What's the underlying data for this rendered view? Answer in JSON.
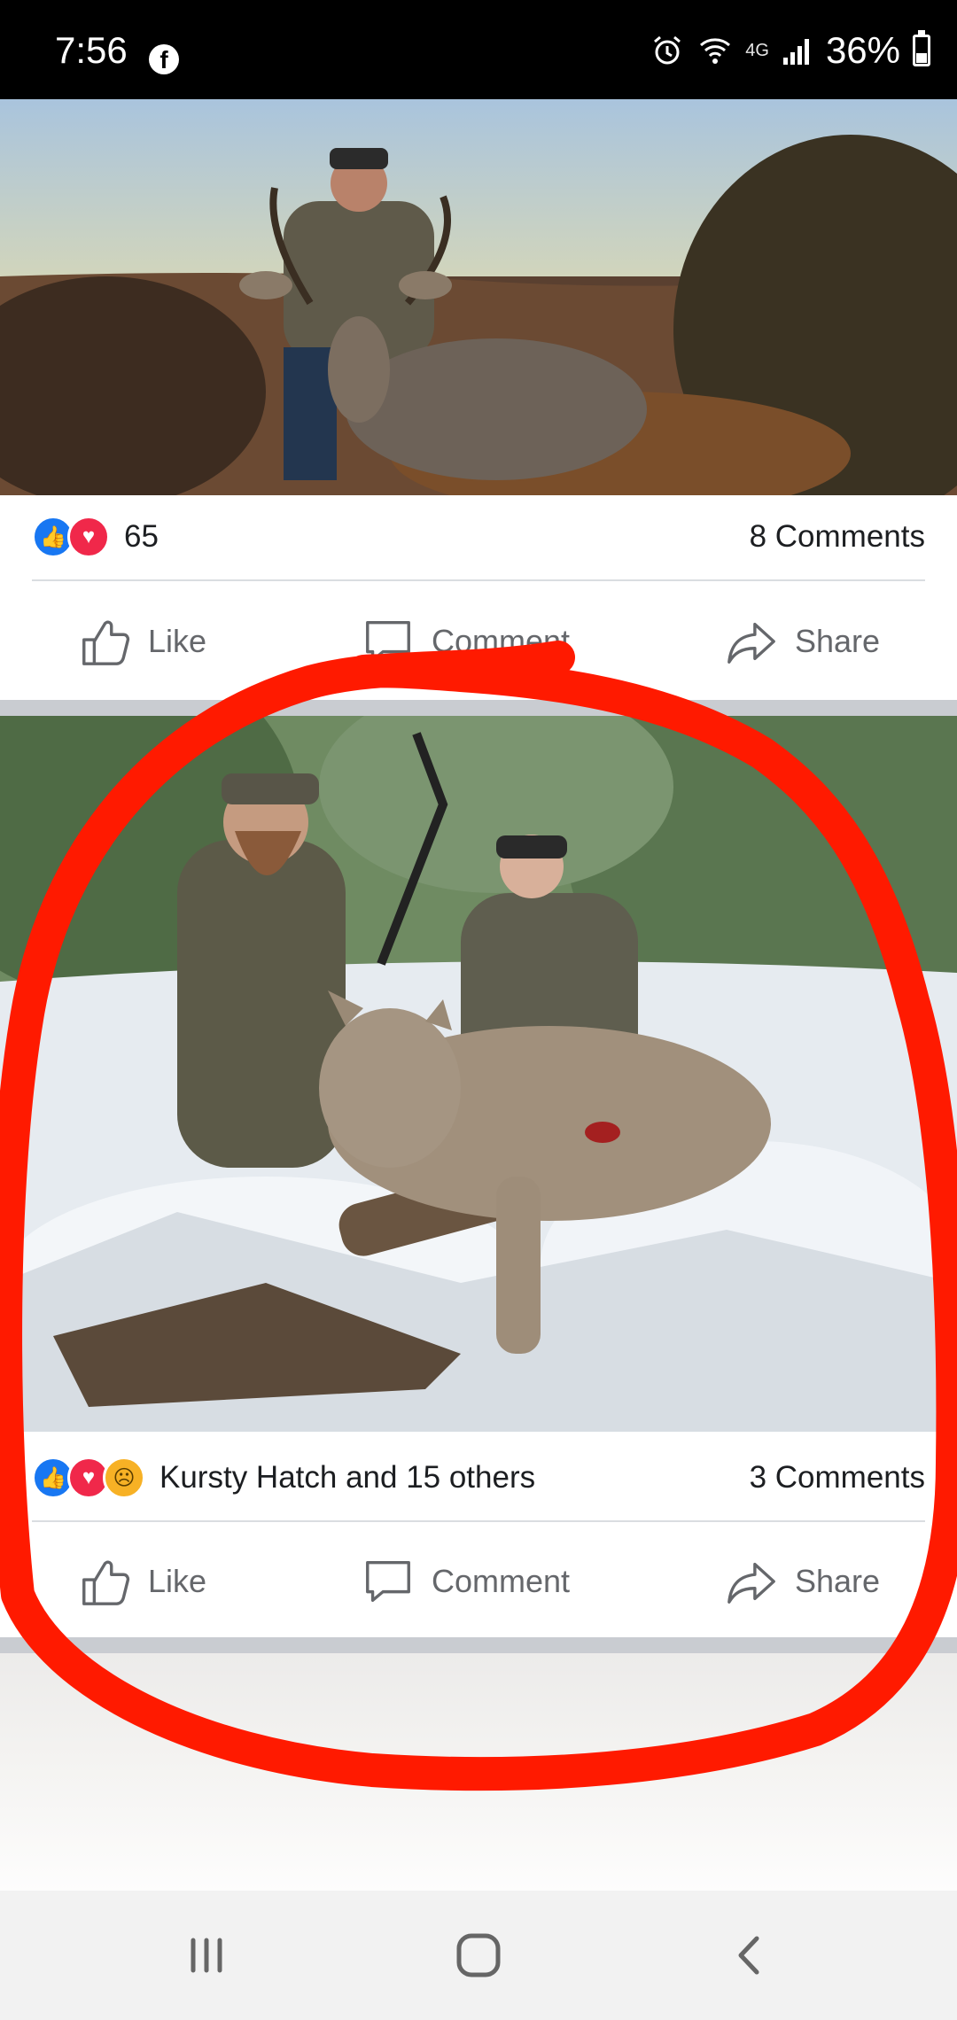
{
  "status_bar": {
    "time": "7:56",
    "network": "4G",
    "battery": "36%",
    "battery_level": 0.36
  },
  "posts": [
    {
      "photo_alt": "Hunter with mule deer",
      "reaction_count": "65",
      "reactions": [
        "like-icon",
        "love-icon"
      ],
      "comments": "8 Comments",
      "actions": {
        "like": "Like",
        "comment": "Comment",
        "share": "Share"
      }
    },
    {
      "photo_alt": "Hunters with mountain lion",
      "reaction_count": "Kursty Hatch and 15 others",
      "reactions": [
        "like-icon",
        "love-icon",
        "sad-icon"
      ],
      "comments": "3 Comments",
      "actions": {
        "like": "Like",
        "comment": "Comment",
        "share": "Share"
      }
    }
  ],
  "colors": {
    "facebook_blue": "#1877f2",
    "love_red": "#f0284a",
    "sad_yellow": "#f7b125",
    "annotation_red": "#ff1a00"
  }
}
